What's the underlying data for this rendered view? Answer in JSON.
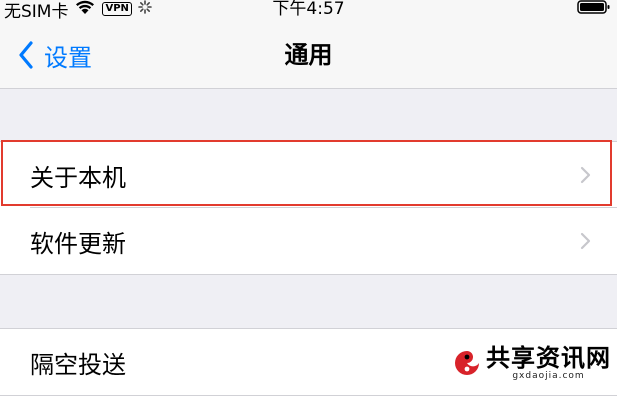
{
  "status_bar": {
    "carrier": "无SIM卡",
    "vpn": "VPN",
    "time": "下午4:57"
  },
  "nav": {
    "back_label": "设置",
    "title": "通用"
  },
  "group1": {
    "items": [
      {
        "label": "关于本机",
        "highlighted": true
      },
      {
        "label": "软件更新",
        "highlighted": false
      }
    ]
  },
  "group2": {
    "items": [
      {
        "label": "隔空投送"
      }
    ]
  },
  "colors": {
    "accent": "#007aff",
    "highlight_border": "#e23b2e",
    "background": "#efeff4"
  },
  "watermark": {
    "title": "共享资讯网",
    "url": "gxdaojia.com"
  }
}
